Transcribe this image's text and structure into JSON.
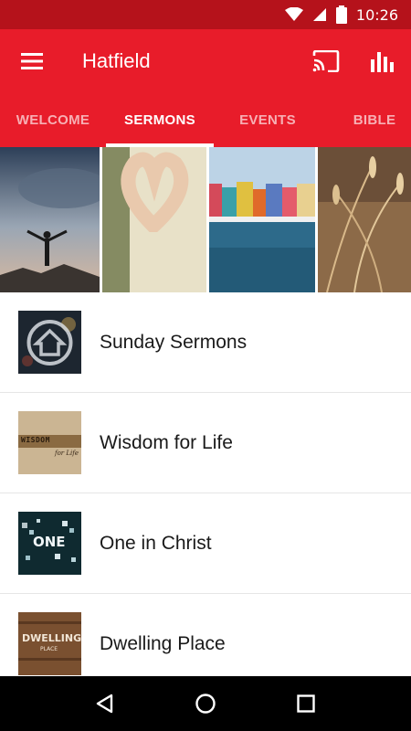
{
  "status_bar": {
    "time": "10:26",
    "icons": [
      "wifi-icon",
      "signal-icon",
      "battery-icon"
    ]
  },
  "app_bar": {
    "title": "Hatfield",
    "icons": [
      "menu-icon",
      "cast-icon",
      "stats-icon"
    ]
  },
  "tabs": [
    {
      "label": "WELCOME",
      "active": false
    },
    {
      "label": "SERMONS",
      "active": true
    },
    {
      "label": "EVENTS",
      "active": false
    },
    {
      "label": "BIBLE",
      "active": false
    }
  ],
  "sermons": [
    {
      "title": "Sunday Sermons",
      "icon": "home-icon"
    },
    {
      "title": "Wisdom for Life",
      "thumb_text": "WISDOM",
      "thumb_subtext": "for Life"
    },
    {
      "title": "One in Christ",
      "thumb_text": "ONE"
    },
    {
      "title": "Dwelling Place",
      "thumb_text": "DWELLING",
      "thumb_subtext": "PLACE"
    }
  ],
  "nav_bar": {
    "icons": [
      "back-icon",
      "home-circle-icon",
      "recents-icon"
    ]
  },
  "colors": {
    "primary": "#e81c2a",
    "status": "#b5121b"
  }
}
